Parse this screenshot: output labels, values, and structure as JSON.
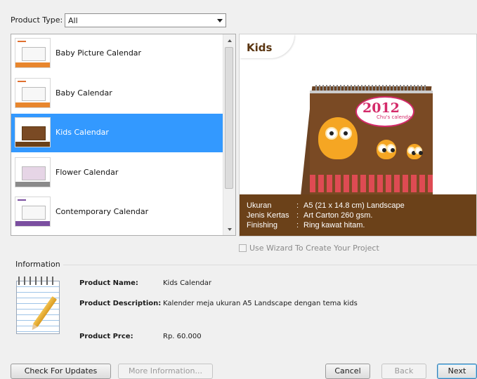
{
  "filter": {
    "label": "Product Type:",
    "value": "All"
  },
  "products": [
    {
      "label": "Baby Picture Calendar",
      "selected": false,
      "accent": "#e8862d"
    },
    {
      "label": "Baby Calendar",
      "selected": false,
      "accent": "#e8862d"
    },
    {
      "label": "Kids Calendar",
      "selected": true,
      "accent": "#6b4119"
    },
    {
      "label": "Flower Calendar",
      "selected": false,
      "accent": "#8a8a8a"
    },
    {
      "label": "Contemporary Calendar",
      "selected": false,
      "accent": "#7b4fa0"
    }
  ],
  "preview": {
    "title": "Kids",
    "calendar_year": "2012",
    "calendar_subtitle": "Chu's calendar",
    "specs": [
      {
        "key": "Ukuran",
        "value": "A5 (21 x 14.8 cm) Landscape"
      },
      {
        "key": "Jenis Kertas",
        "value": "Art Carton 260 gsm."
      },
      {
        "key": "Finishing",
        "value": "Ring kawat hitam."
      }
    ]
  },
  "wizard": {
    "label": "Use Wizard To Create Your Project",
    "checked": false
  },
  "information": {
    "heading": "Information",
    "name_label": "Product Name:",
    "name_value": "Kids Calendar",
    "description_label": "Product Description:",
    "description_value": "Kalender meja ukuran A5 Landscape dengan tema kids",
    "price_label": "Product Prce:",
    "price_value": "Rp. 60.000"
  },
  "buttons": {
    "check_updates": "Check For Updates",
    "more_info": "More Information...",
    "cancel": "Cancel",
    "back": "Back",
    "next": "Next"
  },
  "colors": {
    "selection": "#3399ff",
    "spec_band": "#6b4119",
    "title": "#5a3510"
  }
}
